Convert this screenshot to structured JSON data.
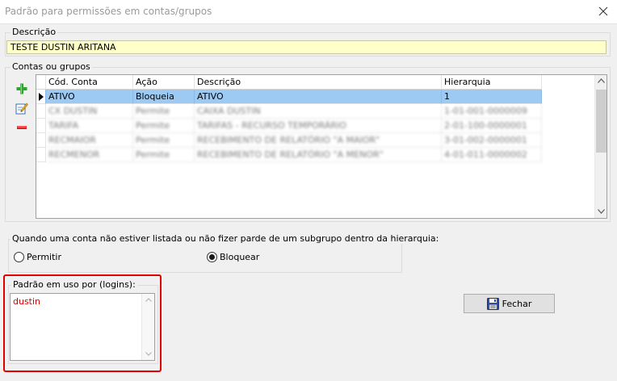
{
  "window": {
    "title": "Padrão para permissões em contas/grupos",
    "close_glyph": "✕"
  },
  "descricao": {
    "label": "Descrição",
    "value": "TESTE DUSTIN ARITANA"
  },
  "contas": {
    "label": "Contas ou grupos",
    "toolbar": {
      "add_icon": "plus-icon",
      "edit_icon": "edit-icon",
      "remove_icon": "minus-icon"
    },
    "columns": [
      "Cód. Conta",
      "Ação",
      "Descrição",
      "Hierarquia"
    ],
    "rows": [
      {
        "conta": "ATIVO",
        "acao": "Bloqueia",
        "descricao": "ATIVO",
        "hierarquia": "1"
      },
      {
        "conta": "CX DUSTIN",
        "acao": "Permite",
        "descricao": "CAIXA DUSTIN",
        "hierarquia": "1-01-001-0000009"
      },
      {
        "conta": "TARIFA",
        "acao": "Permite",
        "descricao": "TARIFAS - RECURSO TEMPORÁRIO",
        "hierarquia": "2-01-100-0000001"
      },
      {
        "conta": "RECMAIOR",
        "acao": "Permite",
        "descricao": "RECEBIMENTO DE RELATÓRIO \"A MAIOR\"",
        "hierarquia": "3-01-002-0000001"
      },
      {
        "conta": "RECMENOR",
        "acao": "Permite",
        "descricao": "RECEBIMENTO DE RELATÓRIO \"A MENOR\"",
        "hierarquia": "4-01-011-0000002"
      }
    ]
  },
  "hierarquia_option": {
    "label": "Quando uma conta não estiver listada ou não fizer parde de um subgrupo dentro da hierarquia:",
    "options": [
      {
        "label": "Permitir",
        "checked": false
      },
      {
        "label": "Bloquear",
        "checked": true
      }
    ]
  },
  "padrao": {
    "label": "Padrão em uso por (logins):",
    "value": "dustin",
    "highlight_color": "#e00000"
  },
  "buttons": {
    "fechar": "Fechar",
    "fechar_icon": "floppy-disk-icon"
  }
}
